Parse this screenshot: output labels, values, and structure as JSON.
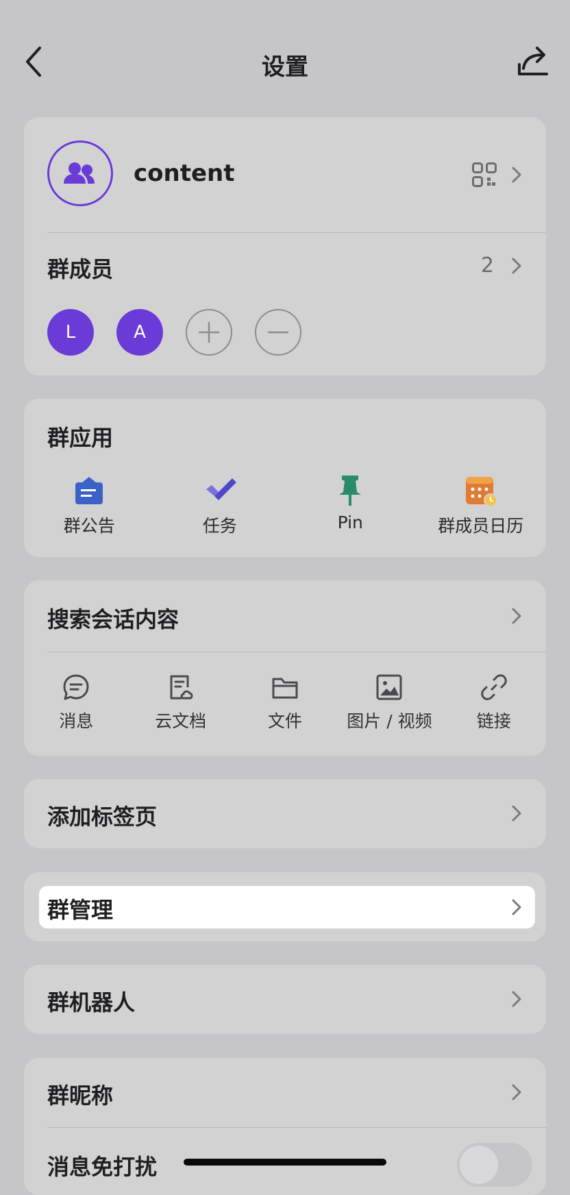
{
  "header": {
    "title": "设置"
  },
  "group": {
    "name": "content",
    "members_label": "群成员",
    "member_count": "2",
    "members": [
      {
        "initial": "L"
      },
      {
        "initial": "A"
      }
    ]
  },
  "apps": {
    "title": "群应用",
    "items": [
      {
        "label": "群公告",
        "icon": "announcement-icon",
        "color": "#3b63c7"
      },
      {
        "label": "任务",
        "icon": "task-icon",
        "color": "#5b52c9"
      },
      {
        "label": "Pin",
        "icon": "pin-icon",
        "color": "#2a8a6c"
      },
      {
        "label": "群成员日历",
        "icon": "calendar-icon",
        "color": "#e07b34"
      }
    ]
  },
  "search": {
    "title": "搜索会话内容",
    "items": [
      {
        "label": "消息",
        "icon": "message-icon"
      },
      {
        "label": "云文档",
        "icon": "cloud-doc-icon"
      },
      {
        "label": "文件",
        "icon": "folder-icon"
      },
      {
        "label": "图片 / 视频",
        "icon": "image-icon"
      },
      {
        "label": "链接",
        "icon": "link-icon"
      }
    ]
  },
  "rows": {
    "add_tab": "添加标签页",
    "manage": "群管理",
    "bots": "群机器人",
    "nickname": "群昵称",
    "mute": "消息免打扰"
  },
  "colors": {
    "accent": "#6a3bd6",
    "card": "#d2d2d3",
    "background": "#c6c6c8"
  },
  "mute_enabled": false
}
